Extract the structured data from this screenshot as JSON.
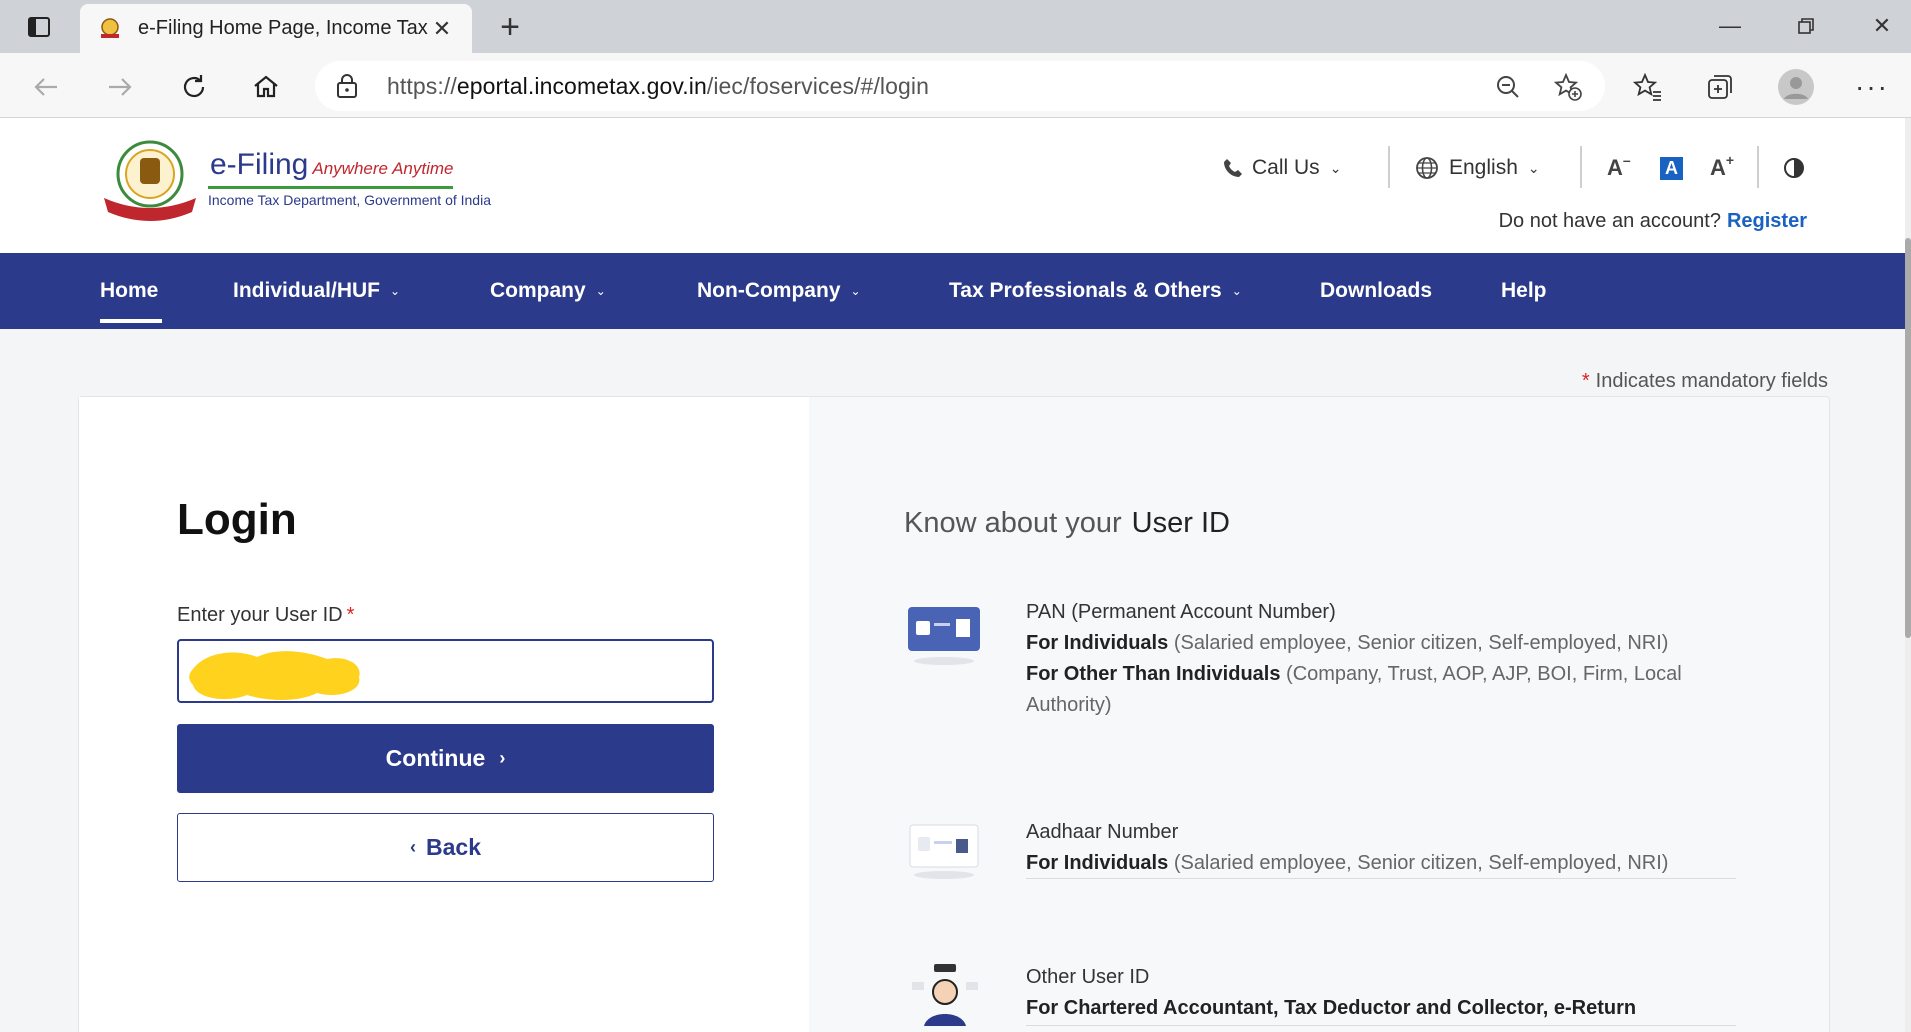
{
  "browser": {
    "tab_title": "e-Filing Home Page, Income Tax",
    "url_prefix": "https://",
    "url_host": "eportal.incometax.gov.in",
    "url_path": "/iec/foservices/#/login"
  },
  "header": {
    "logo_title": "e-Filing",
    "logo_tagline": "Anywhere Anytime",
    "logo_subtitle": "Income Tax Department, Government of India",
    "call_us": "Call Us",
    "language": "English",
    "font_decrease": "A",
    "font_normal": "A",
    "font_increase": "A",
    "account_prompt": "Do not have an account?",
    "register": "Register"
  },
  "nav": {
    "items": [
      {
        "label": "Home"
      },
      {
        "label": "Individual/HUF"
      },
      {
        "label": "Company"
      },
      {
        "label": "Non-Company"
      },
      {
        "label": "Tax Professionals & Others"
      },
      {
        "label": "Downloads"
      },
      {
        "label": "Help"
      }
    ]
  },
  "mandatory_note": "Indicates mandatory fields",
  "login": {
    "title": "Login",
    "field_label": "Enter your User ID",
    "continue": "Continue",
    "back": "Back"
  },
  "know": {
    "prefix": "Know about your",
    "emphasis": "User ID",
    "items": [
      {
        "name": "PAN (Permanent Account Number)",
        "line1_bold": "For Individuals",
        "line1_rest": "(Salaried employee, Senior citizen, Self-employed, NRI)",
        "line2_bold": "For Other Than Individuals",
        "line2_rest": "(Company, Trust, AOP, AJP, BOI, Firm, Local Authority)"
      },
      {
        "name": "Aadhaar Number",
        "line1_bold": "For Individuals",
        "line1_rest": "(Salaried employee, Senior citizen, Self-employed, NRI)"
      },
      {
        "name": "Other User ID",
        "line1_bold": "For Chartered Accountant, Tax Deductor and Collector, e-Return"
      }
    ]
  },
  "colors": {
    "primary": "#2b3a8a",
    "link": "#1a62c2",
    "required": "#dd2222"
  }
}
